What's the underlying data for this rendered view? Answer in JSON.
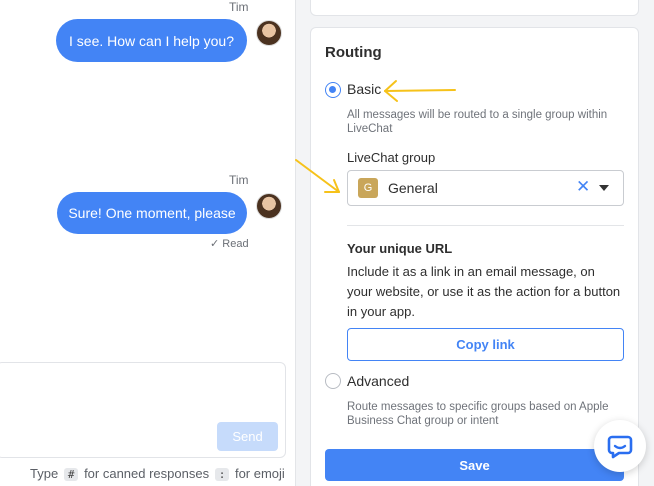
{
  "colors": {
    "accent": "#4384f5",
    "annotation_arrow": "#f6c21a",
    "group_badge": "#c9a65a"
  },
  "chat": {
    "messages": [
      {
        "author": "Tim",
        "text": "I see. How can I help you?"
      },
      {
        "author": "Tim",
        "text": "Sure! One moment, please",
        "status": "✓ Read"
      }
    ],
    "send_label": "Send",
    "hint": {
      "prefix": "Type",
      "key1": "#",
      "mid": "for canned responses",
      "key2": ":",
      "suffix": "for emoji"
    }
  },
  "routing": {
    "title": "Routing",
    "basic": {
      "label": "Basic",
      "selected": true,
      "description": "All messages will be routed to a single group within LiveChat"
    },
    "group_label": "LiveChat group",
    "group": {
      "badge": "G",
      "name": "General"
    },
    "url": {
      "title": "Your unique URL",
      "description": "Include it as a link in an email message, on your website, or use it as the action for a button in your app.",
      "copy_label": "Copy link"
    },
    "advanced": {
      "label": "Advanced",
      "selected": false,
      "description": "Route messages to specific groups based on Apple Business Chat group or intent"
    },
    "save_label": "Save"
  },
  "icons": {
    "clear": "close-icon",
    "dropdown": "chevron-down-icon",
    "chat_widget": "chat-bubble-icon"
  }
}
